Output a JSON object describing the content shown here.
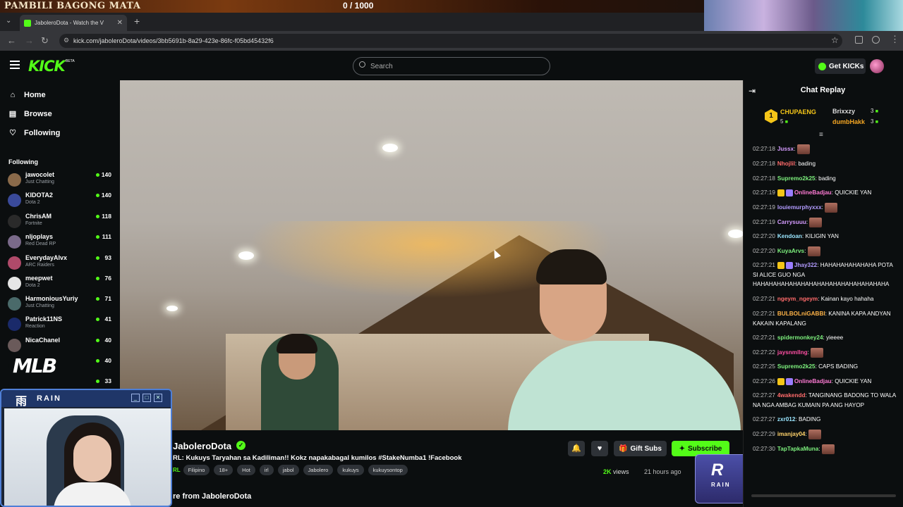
{
  "overlay": {
    "title": "PAMBILI BAGONG MATA",
    "score": "0   / 1000"
  },
  "browser": {
    "tab_title": "JaboleroDota - Watch the V",
    "url": "kick.com/jaboleroDota/videos/3bb5691b-8a29-423e-86fc-f05bd45432f6"
  },
  "header": {
    "logo": "KICK",
    "logo_badge": "BETA",
    "search_placeholder": "Search",
    "get_kicks": "Get KICKs"
  },
  "sidebar": {
    "nav": [
      {
        "label": "Home",
        "icon": "home-icon"
      },
      {
        "label": "Browse",
        "icon": "browse-icon"
      },
      {
        "label": "Following",
        "icon": "heart-icon"
      }
    ],
    "following_heading": "Following",
    "channels": [
      {
        "name": "jawocolet",
        "category": "Just Chatting",
        "viewers": "140",
        "color": "#8a6a4a"
      },
      {
        "name": "KIDOTA2",
        "category": "Dota 2",
        "viewers": "140",
        "color": "#3a4a9a"
      },
      {
        "name": "ChrisAM",
        "category": "Fortnite",
        "viewers": "118",
        "color": "#2a2a2a"
      },
      {
        "name": "nljoplays",
        "category": "Red Dead RP",
        "viewers": "111",
        "color": "#7a6a8a"
      },
      {
        "name": "EverydayAlvx",
        "category": "ARC Raiders",
        "viewers": "93",
        "color": "#b04a6a"
      },
      {
        "name": "meepwet",
        "category": "Dota 2",
        "viewers": "76",
        "color": "#e6e6e6"
      },
      {
        "name": "HarmoniousYuriy",
        "category": "Just Chatting",
        "viewers": "71",
        "color": "#4a6a6a"
      },
      {
        "name": "Patrick11NS",
        "category": "Reaction",
        "viewers": "41",
        "color": "#1a2a6a"
      },
      {
        "name": "NicaChanel",
        "category": "",
        "viewers": "40",
        "color": "#6a5a5a"
      },
      {
        "name": "",
        "category": "",
        "viewers": "40",
        "color": "#0b0e0f"
      },
      {
        "name": "",
        "category": "",
        "viewers": "33",
        "color": "#0b0e0f"
      }
    ],
    "mlb_logo": "MLB"
  },
  "webcam": {
    "brand": "RAIN",
    "logo_glyph": "雨"
  },
  "video_info": {
    "channel": "JaboleroDota",
    "title": "RL: Kukuys Taryahan sa Kadiliman!! Kokz napakabagal kumilos #StakeNumba1 !Facebook",
    "tag_prefix": "RL",
    "tags": [
      "Filipino",
      "18+",
      "Hot",
      "irl",
      "jabol",
      "Jabolero",
      "kukuys",
      "kukuysontop"
    ],
    "gift_subs": "Gift Subs",
    "subscribe": "Subscribe",
    "views_count": "2K",
    "views_label": "views",
    "ago": "21 hours ago",
    "more_from": "re from JaboleroDota",
    "rain_badge": "RAIN"
  },
  "chat": {
    "title": "Chat Replay",
    "leaderboard": [
      {
        "rank": "1",
        "name": "CHUPAENG",
        "count": "5"
      },
      {
        "name": "Brixxzy",
        "count": "3"
      },
      {
        "name": "dumbHakk",
        "count": "3"
      }
    ],
    "messages": [
      {
        "time": "02:27:18",
        "user": "Jussx",
        "color": "#d59bff",
        "text": "",
        "emote": true
      },
      {
        "time": "02:27:18",
        "user": "Nhojlil",
        "color": "#ff6b6b",
        "text": "bading"
      },
      {
        "time": "02:27:18",
        "user": "Supremo2k25",
        "color": "#7df07d",
        "text": "bading"
      },
      {
        "time": "02:27:19",
        "user": "OnlineBadjau",
        "color": "#ff7bd5",
        "text": "QUICKIE YAN",
        "badges": true
      },
      {
        "time": "02:27:19",
        "user": "louiemurphyxxx",
        "color": "#b39cff",
        "text": "",
        "emote": true
      },
      {
        "time": "02:27:19",
        "user": "Carrysuuu",
        "color": "#d59bff",
        "text": "",
        "emote": true
      },
      {
        "time": "02:27:20",
        "user": "Kendoan",
        "color": "#9ae6ff",
        "text": "KILIGIN YAN"
      },
      {
        "time": "02:27:20",
        "user": "KuyaArvs",
        "color": "#7df07d",
        "text": "",
        "emote": true
      },
      {
        "time": "02:27:21",
        "user": "Jhay322",
        "color": "#b39cff",
        "text": "HAHAHAHAHAHAHA POTA SI ALICE GUO NGA HAHAHAHAHAHAHAHAHAHAHAHAHAHAHAHAHA",
        "badges": true
      },
      {
        "time": "02:27:21",
        "user": "ngeym_ngeym",
        "color": "#ff6b6b",
        "text": "Kainan kayo hahaha"
      },
      {
        "time": "02:27:21",
        "user": "BULBOLniGABBI",
        "color": "#ffb347",
        "text": "KANINA KAPA ANDYAN KAKAIN KAPALANG"
      },
      {
        "time": "02:27:21",
        "user": "spidermonkey24",
        "color": "#7df07d",
        "text": "yieeee"
      },
      {
        "time": "02:27:22",
        "user": "jaysnmllng",
        "color": "#ff4fa3",
        "text": "",
        "emote": true
      },
      {
        "time": "02:27:25",
        "user": "Supremo2k25",
        "color": "#7df07d",
        "text": "CAPS BADING"
      },
      {
        "time": "02:27:26",
        "user": "OnlineBadjau",
        "color": "#ff7bd5",
        "text": "QUICKIE YAN",
        "badges": true
      },
      {
        "time": "02:27:27",
        "user": "4wakendd",
        "color": "#ff6b6b",
        "text": "TANGINANG BADONG TO WALA NA NGA AMBAG KUMAIN PA ANG HAYOP"
      },
      {
        "time": "02:27:27",
        "user": "zxr012",
        "color": "#9ae6ff",
        "text": "BADING"
      },
      {
        "time": "02:27:29",
        "user": "imanjay04",
        "color": "#ffd36b",
        "text": "",
        "emote": true
      },
      {
        "time": "02:27:30",
        "user": "TapTapkaMuna",
        "color": "#7df07d",
        "text": "",
        "emote": true
      }
    ]
  },
  "colors": {
    "accent": "#53fc18",
    "background": "#0b0e0f",
    "panel": "#2e3237"
  }
}
